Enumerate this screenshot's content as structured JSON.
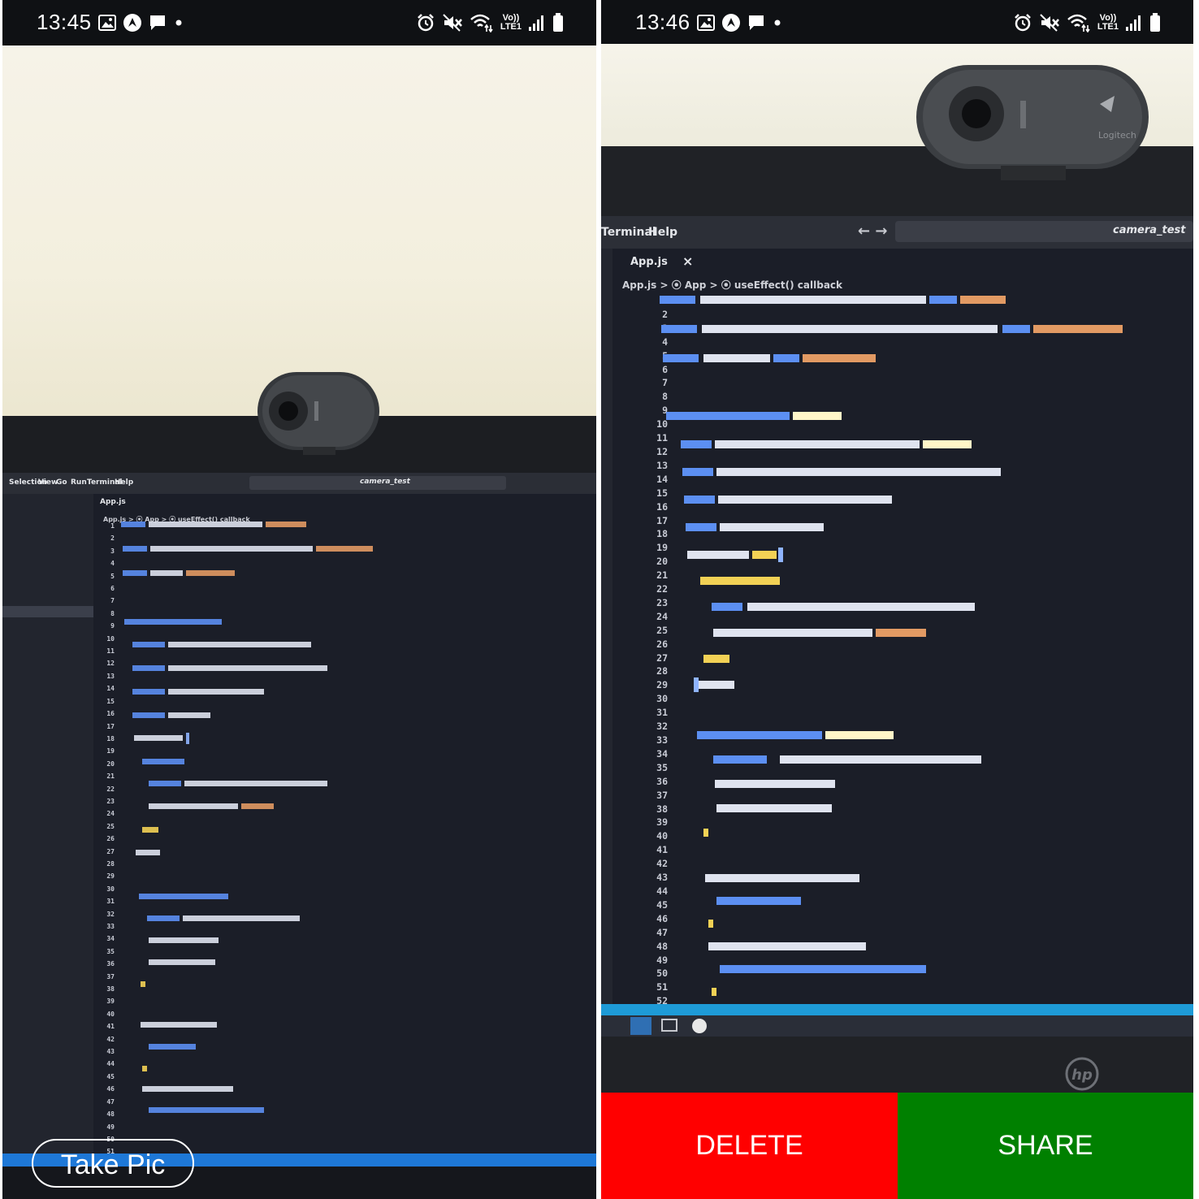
{
  "left_screen": {
    "status_bar": {
      "time": "13:45",
      "volte_top": "Vo))",
      "volte_bottom": "LTE1"
    },
    "take_pic_label": "Take Pic",
    "editor": {
      "menu": [
        "Selection",
        "View",
        "Go",
        "Run",
        "Terminal",
        "Help"
      ],
      "search": "camera_test",
      "tab": "App.js",
      "breadcrumb": "App.js > ⦿ App > ⦿ useEffect() callback"
    }
  },
  "right_screen": {
    "status_bar": {
      "time": "13:46",
      "volte_top": "Vo))",
      "volte_bottom": "LTE1"
    },
    "delete_label": "DELETE",
    "share_label": "SHARE",
    "editor": {
      "menu": [
        "Terminal",
        "Help"
      ],
      "search": "camera_test",
      "tab": "App.js",
      "breadcrumb": "App.js > ⦿ App > ⦿ useEffect() callback"
    },
    "webcam_brand": "Logitech",
    "monitor_brand": "hp"
  },
  "colors": {
    "delete_bg": "#ff0000",
    "share_bg": "#008000",
    "status_bar_bg": "#0f1114",
    "editor_bg": "#1a1d27",
    "vscode_status_bar": "#1e9bd7"
  }
}
